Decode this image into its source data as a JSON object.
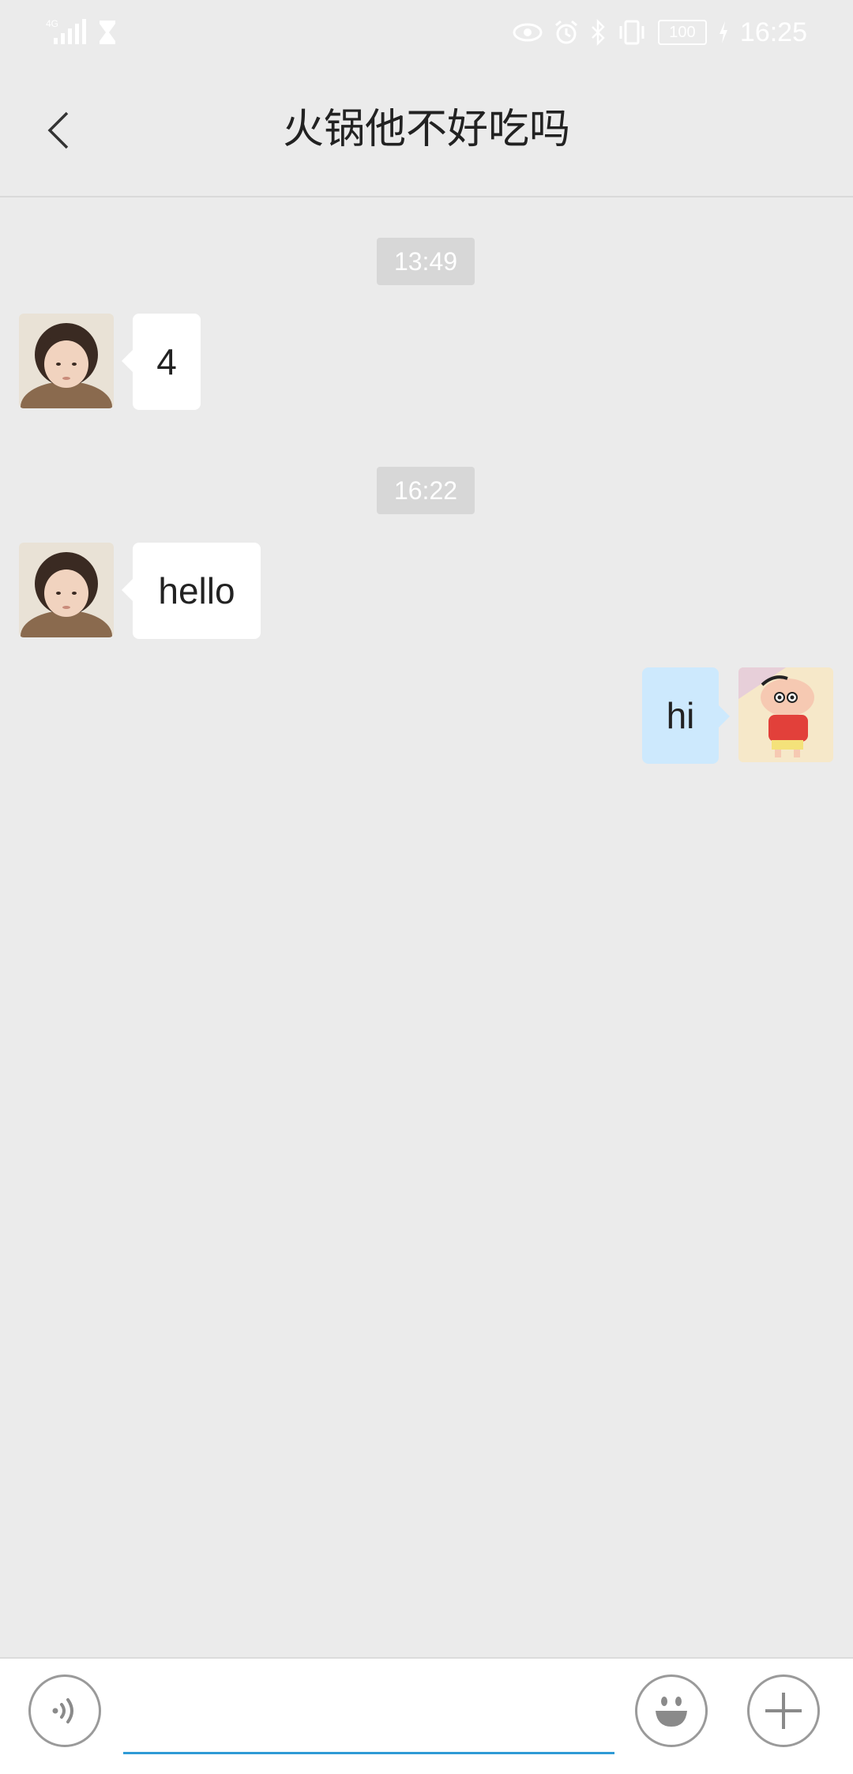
{
  "status_bar": {
    "network": "4G",
    "battery": "100",
    "time": "16:25",
    "icons": [
      "signal-icon",
      "hourglass-icon",
      "eye-icon",
      "alarm-icon",
      "bluetooth-icon",
      "vibrate-icon",
      "battery-icon",
      "charging-icon"
    ]
  },
  "header": {
    "title": "火锅他不好吃吗"
  },
  "messages": [
    {
      "type": "timestamp",
      "text": "13:49"
    },
    {
      "type": "incoming",
      "text": "4",
      "avatar": "girl-avatar"
    },
    {
      "type": "timestamp",
      "text": "16:22"
    },
    {
      "type": "incoming",
      "text": "hello",
      "avatar": "girl-avatar"
    },
    {
      "type": "outgoing",
      "text": "hi",
      "avatar": "cartoon-boy-avatar"
    }
  ],
  "input_bar": {
    "value": "",
    "placeholder": "",
    "buttons": [
      "voice-icon",
      "emoji-icon",
      "plus-icon"
    ]
  },
  "colors": {
    "background": "#ebebeb",
    "outgoing_bubble": "#cde9fd",
    "incoming_bubble": "#ffffff",
    "input_underline": "#2f9bd6"
  }
}
